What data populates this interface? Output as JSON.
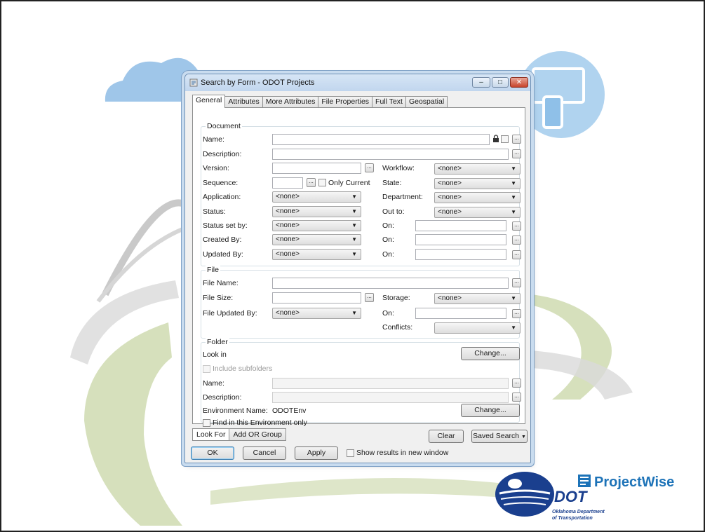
{
  "window": {
    "title": "Search by Form - ODOT Projects"
  },
  "tabs": [
    "General",
    "Attributes",
    "More Attributes",
    "File Properties",
    "Full Text",
    "Geospatial"
  ],
  "document": {
    "title": "Document",
    "name_label": "Name:",
    "description_label": "Description:",
    "version_label": "Version:",
    "sequence_label": "Sequence:",
    "only_current_label": "Only Current",
    "application_label": "Application:",
    "application_value": "<none>",
    "status_label": "Status:",
    "status_value": "<none>",
    "status_set_by_label": "Status set by:",
    "status_set_by_value": "<none>",
    "created_by_label": "Created By:",
    "created_by_value": "<none>",
    "updated_by_label": "Updated By:",
    "updated_by_value": "<none>",
    "workflow_label": "Workflow:",
    "workflow_value": "<none>",
    "state_label": "State:",
    "state_value": "<none>",
    "department_label": "Department:",
    "department_value": "<none>",
    "out_to_label": "Out to:",
    "out_to_value": "<none>",
    "on_label": "On:"
  },
  "file": {
    "title": "File",
    "file_name_label": "File Name:",
    "file_size_label": "File Size:",
    "file_updated_by_label": "File Updated By:",
    "file_updated_by_value": "<none>",
    "storage_label": "Storage:",
    "storage_value": "<none>",
    "on_label": "On:",
    "conflicts_label": "Conflicts:",
    "conflicts_value": ""
  },
  "folder": {
    "title": "Folder",
    "look_in_label": "Look in",
    "change_label": "Change...",
    "include_subfolders_label": "Include subfolders",
    "name_label": "Name:",
    "description_label": "Description:",
    "environment_name_label": "Environment Name:",
    "environment_name_value": "ODOTEnv",
    "find_in_env_label": "Find in this Environment only"
  },
  "bottom_tabs": [
    "Look For",
    "Add OR Group"
  ],
  "buttons": {
    "clear": "Clear",
    "saved_search": "Saved Search",
    "ok": "OK",
    "cancel": "Cancel",
    "apply": "Apply",
    "show_results_label": "Show results in new window"
  },
  "branding": {
    "projectwise": "ProjectWise",
    "odot_line1": "Oklahoma Department",
    "odot_line2": "of Transportation",
    "odot_mark": "DOT"
  },
  "colors": {
    "accent": "#1d73b8",
    "window_border": "#6c8fb5"
  }
}
